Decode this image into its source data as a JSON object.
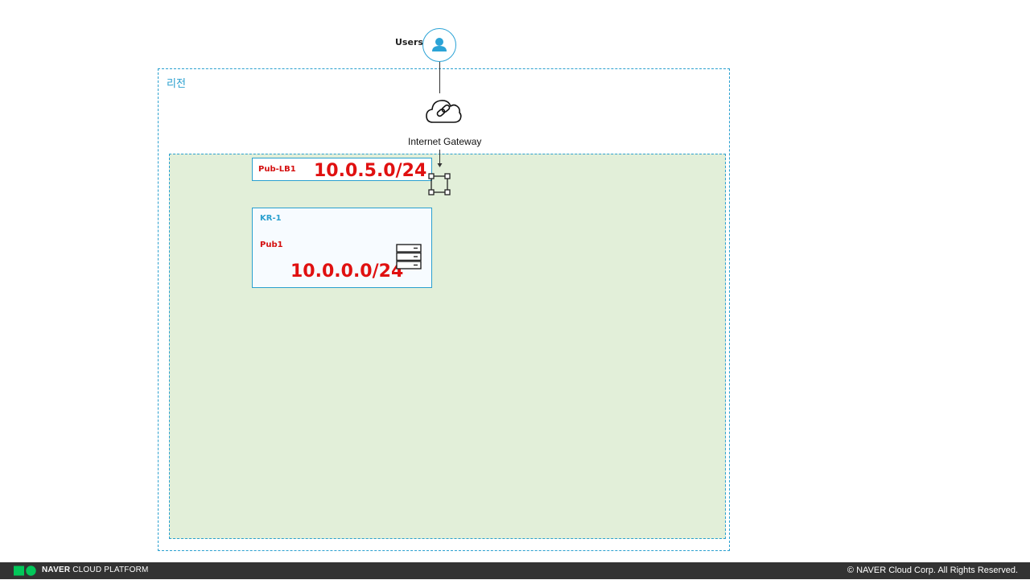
{
  "users": {
    "label": "Users",
    "icon": "user-icon",
    "color": "#2ba3d6"
  },
  "region": {
    "label": "리전",
    "border_color": "#2aa0cf"
  },
  "vpc": {
    "background": "#e2efd9"
  },
  "internet_gateway": {
    "label": "Internet Gateway",
    "icon": "cloud-link-icon"
  },
  "load_balancer_subnet": {
    "label": "Pub-LB1",
    "cidr": "10.0.5.0/24",
    "icon": "load-balancer-icon"
  },
  "zone": {
    "label": "KR-1",
    "subnet": {
      "label": "Pub1",
      "cidr": "10.0.0.0/24",
      "icon": "server-icon"
    }
  },
  "footer": {
    "brand_bold": "NAVER",
    "brand_rest": " CLOUD PLATFORM",
    "copyright": "© NAVER Cloud Corp. All Rights Reserved."
  },
  "colors": {
    "accent": "#2aa0cf",
    "cidr_red": "#e01010",
    "footer_bg": "#333333"
  }
}
